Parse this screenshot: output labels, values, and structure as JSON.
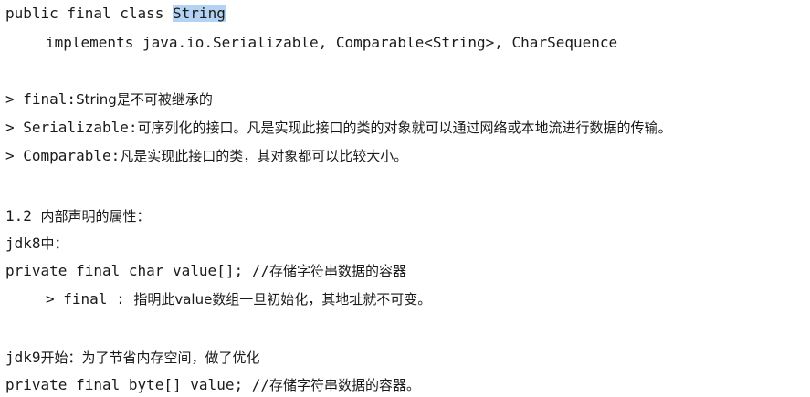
{
  "code_header": {
    "line1_prefix": "public final class ",
    "line1_highlight": "String",
    "line2": "implements java.io.Serializable, Comparable<String>, CharSequence"
  },
  "notes": {
    "final_key": "> final:",
    "final_text": "String是不可被继承的",
    "serializable_key": "> Serializable:",
    "serializable_text": "可序列化的接口。凡是实现此接口的类的对象就可以通过网络或本地流进行数据的传输。",
    "comparable_key": "> Comparable:",
    "comparable_text": "凡是实现此接口的类，其对象都可以比较大小。"
  },
  "section": {
    "heading_num": "1.2 ",
    "heading_text": "内部声明的属性：",
    "jdk8_code": "jdk8",
    "jdk8_text": "中：",
    "jdk8_decl": "private final char value[]; //",
    "jdk8_decl_comment": "存储字符串数据的容器",
    "jdk8_note_code": "> final : ",
    "jdk8_note_text": "指明此value数组一旦初始化，其地址就不可变。",
    "jdk9_code": "jdk9",
    "jdk9_text": "开始：为了节省内存空间，做了优化",
    "jdk9_decl": "private final byte[] value; //",
    "jdk9_decl_comment": "存储字符串数据的容器。"
  }
}
